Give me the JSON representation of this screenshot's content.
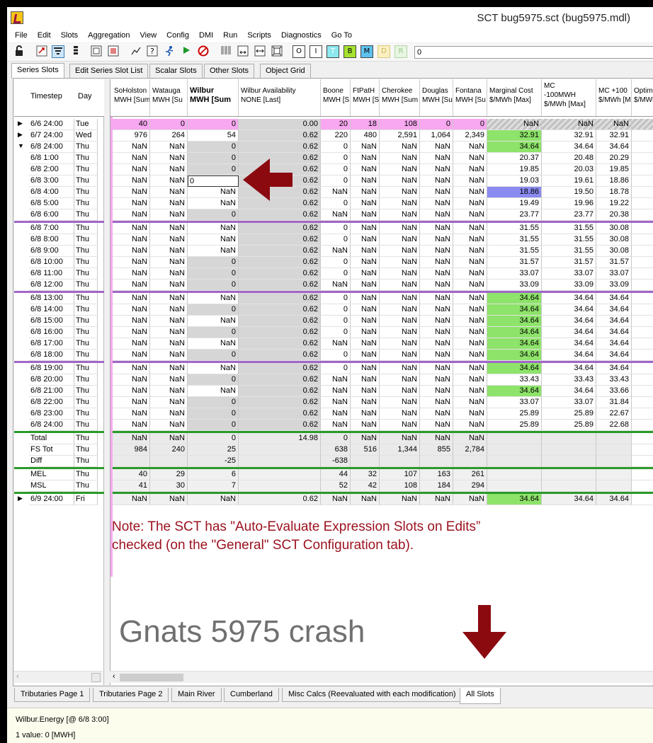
{
  "window": {
    "title": "SCT bug5975.sct (bug5975.mdl)"
  },
  "menu": [
    "File",
    "Edit",
    "Slots",
    "Aggregation",
    "View",
    "Config",
    "DMI",
    "Run",
    "Scripts",
    "Diagnostics",
    "Go To"
  ],
  "toolbar": {
    "field_value": "0",
    "letter_buttons": [
      "O",
      "I",
      "T",
      "B",
      "M",
      "D",
      "R"
    ]
  },
  "tabs_top": [
    "Series Slots",
    "Edit Series Slot List",
    "Scalar Slots",
    "Other Slots",
    "Object Grid"
  ],
  "columns_left": {
    "timestep": "Timestep",
    "day": "Day"
  },
  "columns": [
    {
      "l1": "SoHolston",
      "l2": "MWH [Sum"
    },
    {
      "l1": "Watauga",
      "l2": "MWH [Su"
    },
    {
      "l1": "Wilbur",
      "l2": "MWH [Sum"
    },
    {
      "l1": "Wilbur Availability",
      "l2": "NONE [Last]"
    },
    {
      "l1": "Boone",
      "l2": "MWH [S"
    },
    {
      "l1": "FtPatH",
      "l2": "MWH [S"
    },
    {
      "l1": "Cherokee",
      "l2": "MWH [Sum"
    },
    {
      "l1": "Douglas",
      "l2": "MWH [Su"
    },
    {
      "l1": "Fontana",
      "l2": "MWH [Su"
    },
    {
      "l1": "Marginal Cost",
      "l2": "$/MWh [Max]"
    },
    {
      "l1": "MC",
      "l2": "-100MWH",
      "l3": "$/MWh [Max]"
    },
    {
      "l1": "MC +100",
      "l2": "$/MWh [M"
    },
    {
      "l1": "Optima",
      "l2": "$/MWh"
    }
  ],
  "rows": [
    {
      "ts": "6/6 24:00",
      "day": "Tue",
      "marker": "▶",
      "v": [
        "40",
        "0",
        "0",
        "0.00",
        "20",
        "18",
        "108",
        "0",
        "0",
        "NaN",
        "NaN",
        "NaN",
        ""
      ]
    },
    {
      "ts": "6/7 24:00",
      "day": "Wed",
      "marker": "▶",
      "v": [
        "976",
        "264",
        "54",
        "0.62",
        "220",
        "480",
        "2,591",
        "1,064",
        "2,349",
        "32.91",
        "32.91",
        "32.91",
        ""
      ]
    },
    {
      "ts": "6/8 24:00",
      "day": "Thu",
      "marker": "▼",
      "v": [
        "NaN",
        "NaN",
        "0",
        "0.62",
        "0",
        "NaN",
        "NaN",
        "NaN",
        "NaN",
        "34.64",
        "34.64",
        "34.64",
        ""
      ]
    },
    {
      "ts": "6/8 1:00",
      "day": "Thu",
      "v": [
        "NaN",
        "NaN",
        "0",
        "0.62",
        "0",
        "NaN",
        "NaN",
        "NaN",
        "NaN",
        "20.37",
        "20.48",
        "20.29",
        ""
      ]
    },
    {
      "ts": "6/8 2:00",
      "day": "Thu",
      "v": [
        "NaN",
        "NaN",
        "0",
        "0.62",
        "0",
        "NaN",
        "NaN",
        "NaN",
        "NaN",
        "19.85",
        "20.03",
        "19.85",
        ""
      ]
    },
    {
      "ts": "6/8 3:00",
      "day": "Thu",
      "v": [
        "NaN",
        "NaN",
        "0",
        "0.62",
        "0",
        "NaN",
        "NaN",
        "NaN",
        "NaN",
        "19.03",
        "19.61",
        "18.86",
        ""
      ]
    },
    {
      "ts": "6/8 4:00",
      "day": "Thu",
      "v": [
        "NaN",
        "NaN",
        "NaN",
        "0.62",
        "NaN",
        "NaN",
        "NaN",
        "NaN",
        "NaN",
        "18.86",
        "19.50",
        "18.78",
        ""
      ]
    },
    {
      "ts": "6/8 5:00",
      "day": "Thu",
      "v": [
        "NaN",
        "NaN",
        "NaN",
        "0.62",
        "0",
        "NaN",
        "NaN",
        "NaN",
        "NaN",
        "19.49",
        "19.96",
        "19.22",
        ""
      ]
    },
    {
      "ts": "6/8 6:00",
      "day": "Thu",
      "v": [
        "NaN",
        "NaN",
        "0",
        "0.62",
        "NaN",
        "NaN",
        "NaN",
        "NaN",
        "NaN",
        "23.77",
        "23.77",
        "20.38",
        ""
      ]
    },
    {
      "ts": "6/8 7:00",
      "day": "Thu",
      "v": [
        "NaN",
        "NaN",
        "NaN",
        "0.62",
        "0",
        "NaN",
        "NaN",
        "NaN",
        "NaN",
        "31.55",
        "31.55",
        "30.08",
        ""
      ]
    },
    {
      "ts": "6/8 8:00",
      "day": "Thu",
      "v": [
        "NaN",
        "NaN",
        "NaN",
        "0.62",
        "0",
        "NaN",
        "NaN",
        "NaN",
        "NaN",
        "31.55",
        "31.55",
        "30.08",
        ""
      ]
    },
    {
      "ts": "6/8 9:00",
      "day": "Thu",
      "v": [
        "NaN",
        "NaN",
        "NaN",
        "0.62",
        "NaN",
        "NaN",
        "NaN",
        "NaN",
        "NaN",
        "31.55",
        "31.55",
        "30.08",
        ""
      ]
    },
    {
      "ts": "6/8 10:00",
      "day": "Thu",
      "v": [
        "NaN",
        "NaN",
        "0",
        "0.62",
        "0",
        "NaN",
        "NaN",
        "NaN",
        "NaN",
        "31.57",
        "31.57",
        "31.57",
        ""
      ]
    },
    {
      "ts": "6/8 11:00",
      "day": "Thu",
      "v": [
        "NaN",
        "NaN",
        "0",
        "0.62",
        "0",
        "NaN",
        "NaN",
        "NaN",
        "NaN",
        "33.07",
        "33.07",
        "33.07",
        ""
      ]
    },
    {
      "ts": "6/8 12:00",
      "day": "Thu",
      "v": [
        "NaN",
        "NaN",
        "0",
        "0.62",
        "NaN",
        "NaN",
        "NaN",
        "NaN",
        "NaN",
        "33.09",
        "33.09",
        "33.09",
        ""
      ]
    },
    {
      "ts": "6/8 13:00",
      "day": "Thu",
      "v": [
        "NaN",
        "NaN",
        "NaN",
        "0.62",
        "0",
        "NaN",
        "NaN",
        "NaN",
        "NaN",
        "34.64",
        "34.64",
        "34.64",
        ""
      ]
    },
    {
      "ts": "6/8 14:00",
      "day": "Thu",
      "v": [
        "NaN",
        "NaN",
        "0",
        "0.62",
        "0",
        "NaN",
        "NaN",
        "NaN",
        "NaN",
        "34.64",
        "34.64",
        "34.64",
        ""
      ]
    },
    {
      "ts": "6/8 15:00",
      "day": "Thu",
      "v": [
        "NaN",
        "NaN",
        "NaN",
        "0.62",
        "0",
        "NaN",
        "NaN",
        "NaN",
        "NaN",
        "34.64",
        "34.64",
        "34.64",
        ""
      ]
    },
    {
      "ts": "6/8 16:00",
      "day": "Thu",
      "v": [
        "NaN",
        "NaN",
        "0",
        "0.62",
        "0",
        "NaN",
        "NaN",
        "NaN",
        "NaN",
        "34.64",
        "34.64",
        "34.64",
        ""
      ]
    },
    {
      "ts": "6/8 17:00",
      "day": "Thu",
      "v": [
        "NaN",
        "NaN",
        "NaN",
        "0.62",
        "NaN",
        "NaN",
        "NaN",
        "NaN",
        "NaN",
        "34.64",
        "34.64",
        "34.64",
        ""
      ]
    },
    {
      "ts": "6/8 18:00",
      "day": "Thu",
      "v": [
        "NaN",
        "NaN",
        "0",
        "0.62",
        "0",
        "NaN",
        "NaN",
        "NaN",
        "NaN",
        "34.64",
        "34.64",
        "34.64",
        ""
      ]
    },
    {
      "ts": "6/8 19:00",
      "day": "Thu",
      "v": [
        "NaN",
        "NaN",
        "NaN",
        "0.62",
        "0",
        "NaN",
        "NaN",
        "NaN",
        "NaN",
        "34.64",
        "34.64",
        "34.64",
        ""
      ]
    },
    {
      "ts": "6/8 20:00",
      "day": "Thu",
      "v": [
        "NaN",
        "NaN",
        "0",
        "0.62",
        "NaN",
        "NaN",
        "NaN",
        "NaN",
        "NaN",
        "33.43",
        "33.43",
        "33.43",
        ""
      ]
    },
    {
      "ts": "6/8 21:00",
      "day": "Thu",
      "v": [
        "NaN",
        "NaN",
        "NaN",
        "0.62",
        "NaN",
        "NaN",
        "NaN",
        "NaN",
        "NaN",
        "34.64",
        "34.64",
        "33.66",
        ""
      ]
    },
    {
      "ts": "6/8 22:00",
      "day": "Thu",
      "v": [
        "NaN",
        "NaN",
        "0",
        "0.62",
        "NaN",
        "NaN",
        "NaN",
        "NaN",
        "NaN",
        "33.07",
        "33.07",
        "31.84",
        ""
      ]
    },
    {
      "ts": "6/8 23:00",
      "day": "Thu",
      "v": [
        "NaN",
        "NaN",
        "0",
        "0.62",
        "NaN",
        "NaN",
        "NaN",
        "NaN",
        "NaN",
        "25.89",
        "25.89",
        "22.67",
        ""
      ]
    },
    {
      "ts": "6/8 24:00",
      "day": "Thu",
      "v": [
        "NaN",
        "NaN",
        "0",
        "0.62",
        "NaN",
        "NaN",
        "NaN",
        "NaN",
        "NaN",
        "25.89",
        "25.89",
        "22.68",
        ""
      ]
    },
    {
      "ts": "Total",
      "day": "Thu",
      "v": [
        "NaN",
        "NaN",
        "0",
        "14.98",
        "0",
        "NaN",
        "NaN",
        "NaN",
        "NaN",
        "",
        "",
        "",
        ""
      ]
    },
    {
      "ts": "FS Tot",
      "day": "Thu",
      "v": [
        "984",
        "240",
        "25",
        "",
        "638",
        "516",
        "1,344",
        "855",
        "2,784",
        "",
        "",
        "",
        ""
      ]
    },
    {
      "ts": "Diff",
      "day": "Thu",
      "v": [
        "",
        "",
        "-25",
        "",
        "-638",
        "",
        "",
        "",
        "",
        "",
        "",
        "",
        ""
      ]
    },
    {
      "ts": "MEL",
      "day": "Thu",
      "v": [
        "40",
        "29",
        "6",
        "",
        "44",
        "32",
        "107",
        "163",
        "261",
        "",
        "",
        "",
        ""
      ]
    },
    {
      "ts": "MSL",
      "day": "Thu",
      "v": [
        "41",
        "30",
        "7",
        "",
        "52",
        "42",
        "108",
        "184",
        "294",
        "",
        "",
        "",
        ""
      ]
    },
    {
      "ts": "6/9 24:00",
      "day": "Fri",
      "marker": "▶",
      "v": [
        "NaN",
        "NaN",
        "NaN",
        "0.62",
        "NaN",
        "NaN",
        "NaN",
        "NaN",
        "NaN",
        "34.64",
        "34.64",
        "34.64",
        ""
      ]
    }
  ],
  "editing_cell_value": "0",
  "note": {
    "line1": "Note: The SCT has \"Auto-Evaluate Expression Slots on Edits”",
    "line2": "checked (on the \"General\" SCT Configuration tab)."
  },
  "annotation_title": "Gnats 5975 crash",
  "tabs_bottom": [
    "Tributaries Page 1",
    "Tributaries Page 2",
    "Main River",
    "Cumberland",
    "Misc Calcs (Reevaluated with each modification)",
    "All Slots"
  ],
  "status": {
    "line1": "Wilbur.Energy [@ 6/8 3:00]",
    "line2": "1 value:  0 [MWH]"
  },
  "colors": {
    "pink": "#f7a8f0",
    "green": "#8ee36a",
    "gray": "#d6d6d6",
    "purple": "#a066c8",
    "sep_green": "#2a9a2a",
    "note_red": "#9b111e"
  }
}
